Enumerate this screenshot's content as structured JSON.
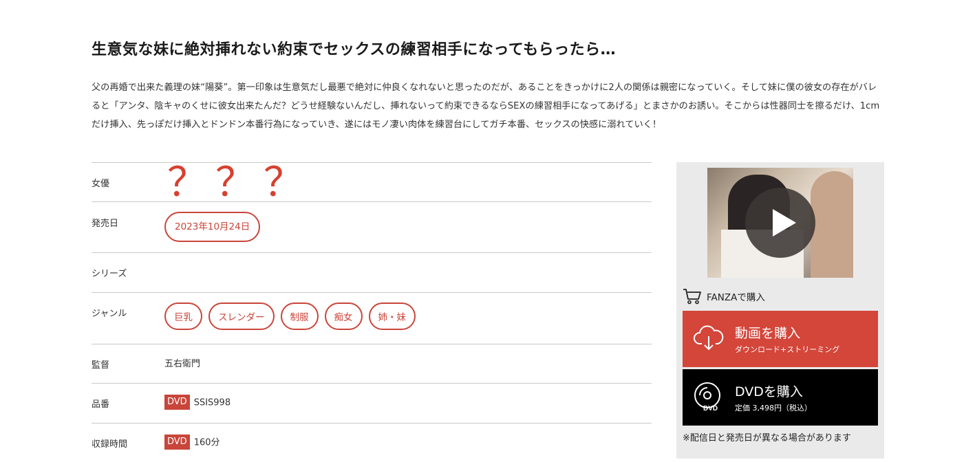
{
  "title": "生意気な妹に絶対挿れない約束でセックスの練習相手になってもらったら…",
  "description": "父の再婚で出来た義理の妹“陽葵”。第一印象は生意気だし最悪で絶対に仲良くなれないと思ったのだが、あることをきっかけに2人の関係は親密になっていく。そして妹に僕の彼女の存在がバレると「アンタ、陰キャのくせに彼女出来たんだ？どうせ経験ないんだし、挿れないって約束できるならSEXの練習相手になってあげる」とまさかのお誘い。そこからは性器同士を擦るだけ、1cmだけ挿入、先っぽだけ挿入とドンドン本番行為になっていき、遂にはモノ凄い肉体を練習台にしてガチ本番、セックスの快感に溺れていく！",
  "spec": {
    "actress": {
      "label": "女優",
      "marks": [
        "？",
        "？",
        "？"
      ]
    },
    "release": {
      "label": "発売日",
      "value": "2023年10月24日"
    },
    "series": {
      "label": "シリーズ"
    },
    "genre": {
      "label": "ジャンル",
      "items": [
        "巨乳",
        "スレンダー",
        "制服",
        "痴女",
        "姉・妹"
      ]
    },
    "director": {
      "label": "監督",
      "value": "五右衛門"
    },
    "product_code": {
      "label": "品番",
      "tag": "DVD",
      "value": "SSIS998"
    },
    "duration": {
      "label": "収録時間",
      "tag": "DVD",
      "value": "160分"
    }
  },
  "sidebar": {
    "fanza_label": "FANZAで購入",
    "video_button": {
      "main": "動画を購入",
      "sub": "ダウンロード+ストリーミング"
    },
    "dvd_button": {
      "main": "DVDを購入",
      "sub": "定価 3,498円（税込）",
      "icon_text": "DVD"
    },
    "note": "※配信日と発売日が異なる場合があります"
  },
  "colors": {
    "accent": "#c9453a",
    "video_bg": "#d4453a",
    "dvd_bg": "#000000",
    "sidebar_bg": "#eaeaea"
  }
}
